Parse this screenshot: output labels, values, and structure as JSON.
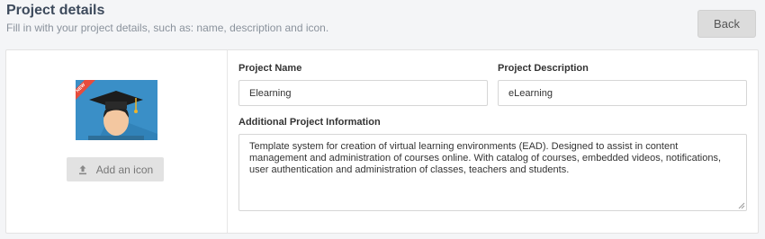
{
  "header": {
    "title": "Project details",
    "subtitle": "Fill in with your project details, such as: name, description and icon."
  },
  "back_label": "Back",
  "icon_panel": {
    "add_icon_label": "Add an icon",
    "badge_text": "NEW",
    "upload_icon": "upload-icon"
  },
  "form": {
    "name_label": "Project Name",
    "name_value": "Elearning",
    "description_label": "Project Description",
    "description_value": "eLearning",
    "info_label": "Additional Project Information",
    "info_value": "Template system for creation of virtual learning environments (EAD). Designed to assist in content management and administration of courses online. With catalog of courses, embedded videos, notifications, user authentication and administration of classes, teachers and students."
  },
  "colors": {
    "title": "#3d4a5c",
    "thumbnail_bg": "#3a8fc7",
    "badge": "#e74c3c"
  }
}
